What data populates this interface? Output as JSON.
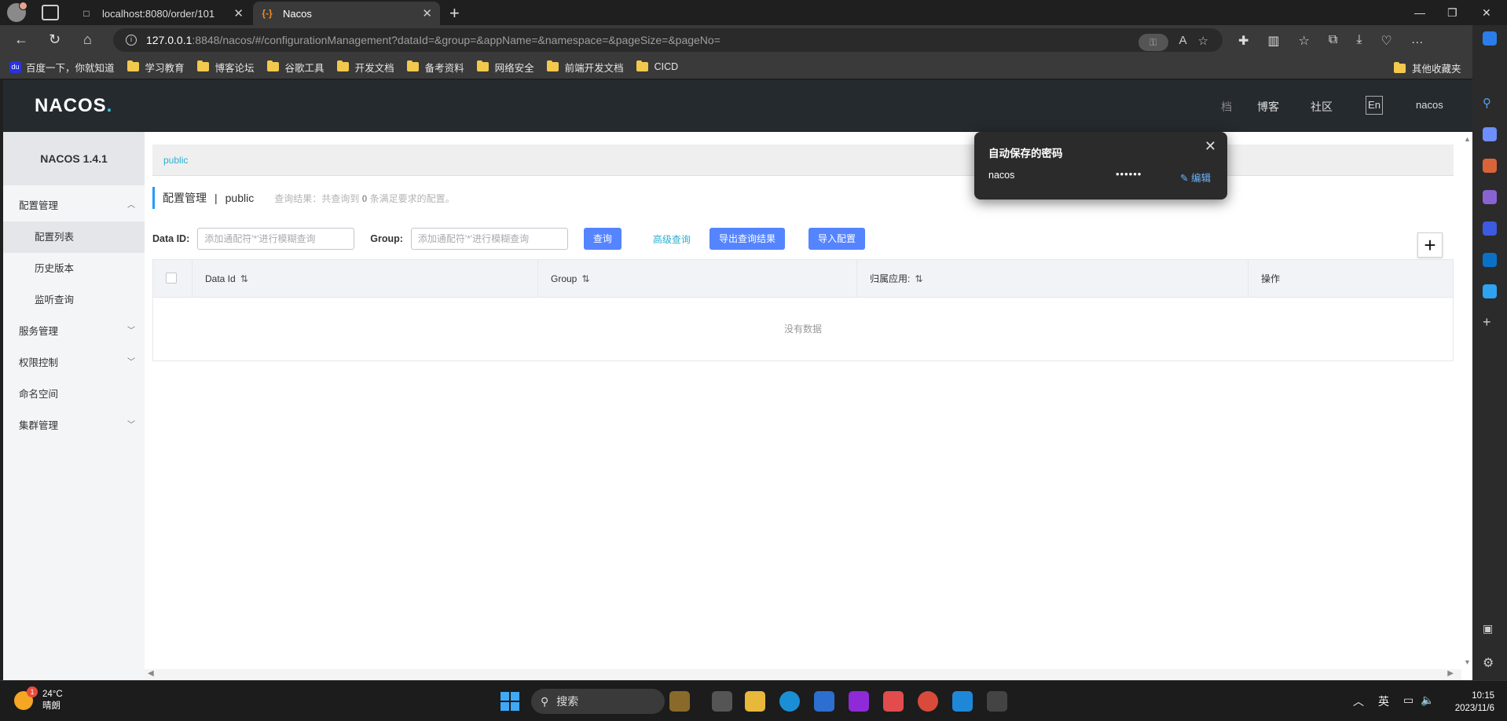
{
  "browser": {
    "tabs": [
      {
        "title": "localhost:8080/order/101",
        "icon": "page-icon"
      },
      {
        "title": "Nacos",
        "icon": "nacos-favicon"
      }
    ],
    "url_host": "127.0.0.1",
    "url_rest": ":8848/nacos/#/configurationManagement?dataId=&group=&appName=&namespace=&pageSize=&pageNo=",
    "bookmarks": [
      {
        "label": "百度一下，你就知道",
        "icon": "baidu-icon"
      },
      {
        "label": "学习教育",
        "icon": "folder-icon"
      },
      {
        "label": "博客论坛",
        "icon": "folder-icon"
      },
      {
        "label": "谷歌工具",
        "icon": "folder-icon"
      },
      {
        "label": "开发文档",
        "icon": "folder-icon"
      },
      {
        "label": "备考资料",
        "icon": "folder-icon"
      },
      {
        "label": "网络安全",
        "icon": "folder-icon"
      },
      {
        "label": "前端开发文档",
        "icon": "folder-icon"
      },
      {
        "label": "CICD",
        "icon": "folder-icon"
      }
    ],
    "other_bookmarks": "其他收藏夹"
  },
  "password_popup": {
    "title": "自动保存的密码",
    "username": "nacos",
    "password_mask": "••••••",
    "edit_label": "编辑"
  },
  "header": {
    "logo": "NACOS",
    "nav_partial": "档",
    "nav_blog": "博客",
    "nav_community": "社区",
    "lang": "En",
    "user": "nacos"
  },
  "sidebar": {
    "version": "NACOS 1.4.1",
    "items": [
      {
        "label": "配置管理",
        "chev": "︿"
      },
      {
        "label": "配置列表"
      },
      {
        "label": "历史版本"
      },
      {
        "label": "监听查询"
      },
      {
        "label": "服务管理",
        "chev": "﹀"
      },
      {
        "label": "权限控制",
        "chev": "﹀"
      },
      {
        "label": "命名空间"
      },
      {
        "label": "集群管理",
        "chev": "﹀"
      }
    ]
  },
  "main": {
    "namespace": "public",
    "title": "配置管理",
    "title_sep": "|",
    "title_ns": "public",
    "result_prefix": "查询结果：共查询到",
    "result_count": "0",
    "result_suffix": "条满足要求的配置。",
    "filters": {
      "data_id_label": "Data ID:",
      "data_id_placeholder": "添加通配符'*'进行模糊查询",
      "group_label": "Group:",
      "group_placeholder": "添加通配符'*'进行模糊查询",
      "query": "查询",
      "advanced": "高级查询",
      "export": "导出查询结果",
      "import": "导入配置",
      "add": "+"
    },
    "table": {
      "columns": [
        "Data Id",
        "Group",
        "归属应用:",
        "操作"
      ],
      "empty": "没有数据"
    }
  },
  "taskbar": {
    "temp": "24°C",
    "weather": "晴朗",
    "badge": "1",
    "search": "搜索",
    "ime": "英",
    "time": "10:15",
    "date": "2023/11/6"
  }
}
